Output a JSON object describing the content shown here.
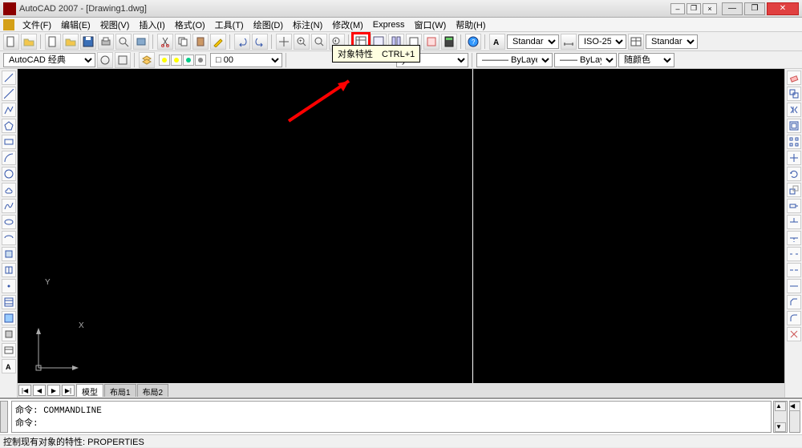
{
  "window": {
    "title": "AutoCAD 2007 - [Drawing1.dwg]",
    "min": "—",
    "max": "❐",
    "close": "✕",
    "doc_min": "–",
    "doc_max": "❐",
    "doc_close": "×"
  },
  "menu": {
    "items": [
      "文件(F)",
      "编辑(E)",
      "视图(V)",
      "插入(I)",
      "格式(O)",
      "工具(T)",
      "绘图(D)",
      "标注(N)",
      "修改(M)",
      "Express",
      "窗口(W)",
      "帮助(H)"
    ]
  },
  "tooltip": {
    "text": "对象特性　CTRL+1"
  },
  "toolbar1": {
    "buttons": [
      "new",
      "open",
      "save",
      "plot",
      "preview",
      "publish",
      "cut",
      "copy",
      "paste",
      "match",
      "undo",
      "redo",
      "pan",
      "zoom-rt",
      "zoom-win",
      "zoom-prev",
      "zoom-ext",
      "zoom-all",
      "properties",
      "dcenter",
      "toolpal",
      "sheet",
      "markup",
      "calc",
      "help"
    ],
    "highlight_index": 18,
    "style": "Standard",
    "dimstyle": "ISO-25",
    "tablestyle": "Standard"
  },
  "toolbar2": {
    "workspace": "AutoCAD 经典",
    "layer": "0",
    "layer_visible_suffix": "yer",
    "linetype": "ByLayer",
    "lineweight": "ByLayer",
    "color": "随颜色"
  },
  "tabs": {
    "nav": [
      "|◀",
      "◀",
      "▶",
      "▶|"
    ],
    "items": [
      "模型",
      "布局1",
      "布局2"
    ],
    "active": 0
  },
  "cmd": {
    "line1": "命令: COMMANDLINE",
    "line2": "命令:"
  },
  "status": {
    "text": "控制现有对象的特性: PROPERTIES"
  },
  "ucs": {
    "x": "X",
    "y": "Y"
  }
}
